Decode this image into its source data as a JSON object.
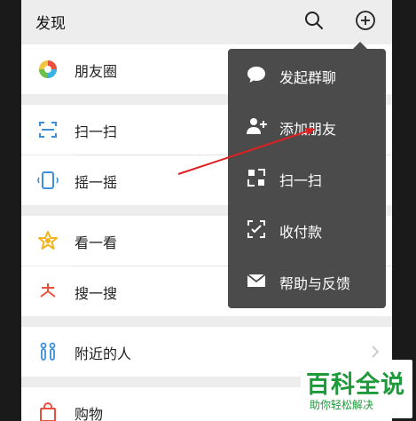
{
  "header": {
    "title": "发现"
  },
  "rows": [
    {
      "label": "朋友圈"
    },
    {
      "label": "扫一扫"
    },
    {
      "label": "摇一摇"
    },
    {
      "label": "看一看"
    },
    {
      "label": "搜一搜"
    },
    {
      "label": "附近的人"
    },
    {
      "label": "购物"
    }
  ],
  "popup_menu": {
    "items": [
      {
        "label": "发起群聊",
        "icon": "chat-bubble-icon"
      },
      {
        "label": "添加朋友",
        "icon": "add-friend-icon"
      },
      {
        "label": "扫一扫",
        "icon": "scan-icon"
      },
      {
        "label": "收付款",
        "icon": "payment-icon"
      },
      {
        "label": "帮助与反馈",
        "icon": "mail-icon"
      }
    ]
  },
  "watermark": {
    "main": "百科全说",
    "sub": "助你轻松解决"
  },
  "colors": {
    "menu_bg": "#4b4b4b",
    "arrow": "#e02020",
    "watermark": "#1f9a3b"
  }
}
